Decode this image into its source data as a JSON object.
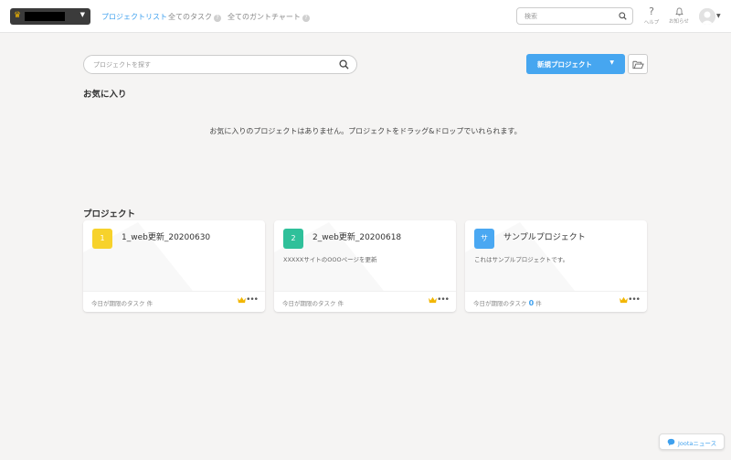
{
  "nav": {
    "tabs": [
      {
        "label": "プロジェクトリスト"
      },
      {
        "label": "全てのタスク"
      },
      {
        "label": "全てのガントチャート"
      }
    ],
    "help_mark": "?",
    "search_placeholder": "検索",
    "help_label": "ヘルプ",
    "notifications_label": "お知らせ"
  },
  "main": {
    "project_search_placeholder": "プロジェクトを探す",
    "new_project_label": "新規プロジェクト",
    "favorites": {
      "title": "お気に入り",
      "empty_message": "お気に入りのプロジェクトはありません。プロジェクトをドラッグ&ドロップでいれられます。"
    },
    "projects": {
      "title": "プロジェクト",
      "cards": [
        {
          "badge": "1",
          "badge_color": "#f7d22b",
          "name": "1_web更新_20200630",
          "desc": "",
          "due_prefix": "今日が期限のタスク",
          "due_count": "",
          "due_suffix": "件"
        },
        {
          "badge": "2",
          "badge_color": "#2fc09a",
          "name": "2_web更新_20200618",
          "desc": "XXXXXサイトのOOOページを更新",
          "due_prefix": "今日が期限のタスク",
          "due_count": "",
          "due_suffix": "件"
        },
        {
          "badge": "サ",
          "badge_color": "#4aa8f2",
          "name": "サンプルプロジェクト",
          "desc": "これはサンプルプロジェクトです。",
          "due_prefix": "今日が期限のタスク",
          "due_count": "0",
          "due_suffix": "件"
        }
      ]
    }
  },
  "footer": {
    "news_label": "Jootaニュース"
  },
  "colors": {
    "accent": "#3ea0ee",
    "primary_button": "#46a6f0",
    "crown": "#f2b600"
  }
}
